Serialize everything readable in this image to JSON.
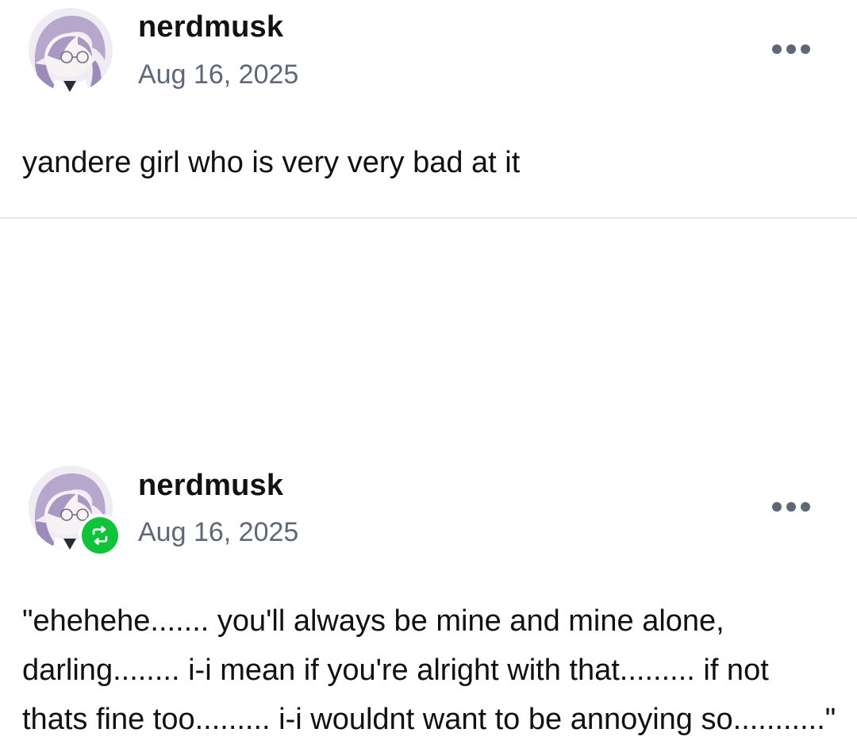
{
  "posts": [
    {
      "username": "nerdmusk",
      "date": "Aug 16, 2025",
      "avatar_icon": "anime-avatar-icon",
      "more_icon": "more-options-icon",
      "body": "yandere girl who is very very bad at it"
    },
    {
      "username": "nerdmusk",
      "date": "Aug 16, 2025",
      "avatar_icon": "anime-avatar-icon",
      "badge_icon": "reblog-icon",
      "badge_color": "#10c33a",
      "more_icon": "more-options-icon",
      "body": "\"ehehehe....... you'll always be mine and mine alone, darling........ i-i mean if you're alright with that......... if not thats fine too......... i-i wouldnt want to be annoying so...........\""
    }
  ]
}
